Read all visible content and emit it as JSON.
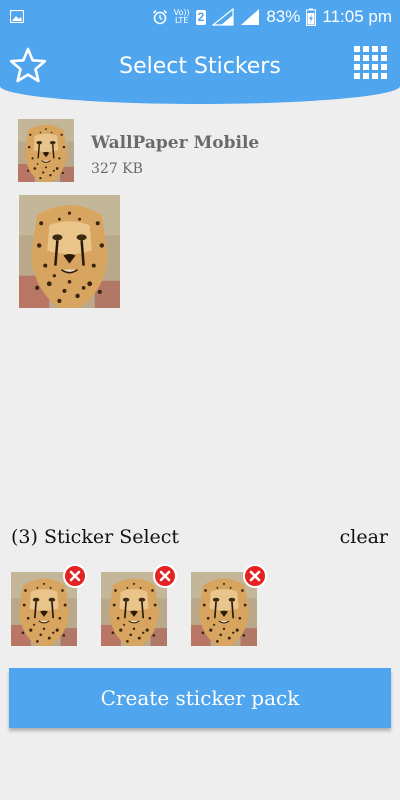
{
  "status_bar": {
    "volte_label": "Vo))",
    "lte_label": "LTE",
    "sim_number": "2",
    "battery": "83%",
    "time": "11:05 pm"
  },
  "toolbar": {
    "title": "Select Stickers",
    "left_icon": "star-outline-icon",
    "right_icon": "grid-icon"
  },
  "pack": {
    "name": "WallPaper Mobile",
    "size": "327 KB"
  },
  "selection": {
    "label": "(3) Sticker Select",
    "clear_label": "clear",
    "count": 3
  },
  "create_button": {
    "label": "Create sticker pack"
  },
  "colors": {
    "primary": "#4fa6ee",
    "remove": "#e52222",
    "background": "#eeeeee"
  }
}
